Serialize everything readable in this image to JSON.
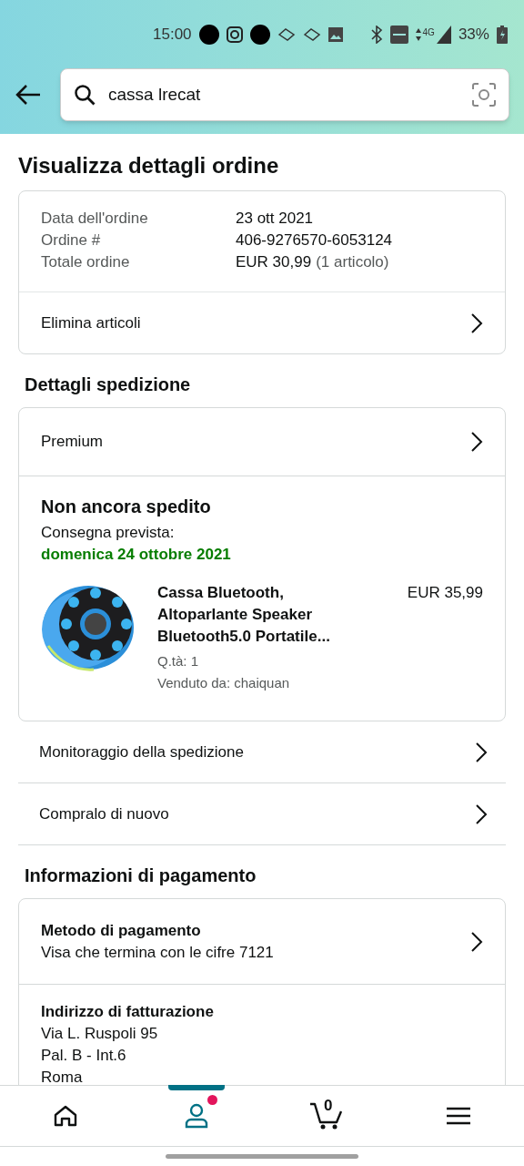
{
  "status_bar": {
    "time": "15:00",
    "battery": "33%",
    "network": "4G"
  },
  "search": {
    "value": "cassa lrecat"
  },
  "title": "Visualizza dettagli ordine",
  "summary": {
    "fields": [
      {
        "label": "Data dell'ordine",
        "value": "23 ott 2021"
      },
      {
        "label": "Ordine #",
        "value": "406-9276570-6053124"
      },
      {
        "label": "Totale ordine",
        "value": "EUR 30,99",
        "note": "(1 articolo)"
      }
    ],
    "action": "Elimina articoli"
  },
  "shipping": {
    "heading": "Dettagli spedizione",
    "method": "Premium",
    "status": "Non ancora spedito",
    "delivery_label": "Consegna prevista:",
    "delivery_date": "domenica 24 ottobre 2021",
    "item": {
      "title": "Cassa Bluetooth, Altoparlante Speaker Bluetooth5.0 Portatile...",
      "price": "EUR 35,99",
      "qty": "Q.tà: 1",
      "seller": "Venduto da: chaiquan"
    },
    "links": [
      "Monitoraggio della spedizione",
      "Compralo di nuovo"
    ]
  },
  "payment": {
    "heading": "Informazioni di pagamento",
    "method": {
      "title": "Metodo di pagamento",
      "detail": "Visa che termina con le cifre 7121"
    },
    "billing": {
      "title": "Indirizzo di fatturazione",
      "lines": [
        "Via L. Ruspoli 95",
        "Pal. B - Int.6",
        "Roma"
      ]
    }
  },
  "nav": [
    {
      "kind": "home",
      "selected": false,
      "dot": false
    },
    {
      "kind": "account",
      "selected": true,
      "dot": true
    },
    {
      "kind": "cart",
      "selected": false,
      "dot": false,
      "count": "0"
    },
    {
      "kind": "menu",
      "selected": false,
      "dot": false
    }
  ]
}
